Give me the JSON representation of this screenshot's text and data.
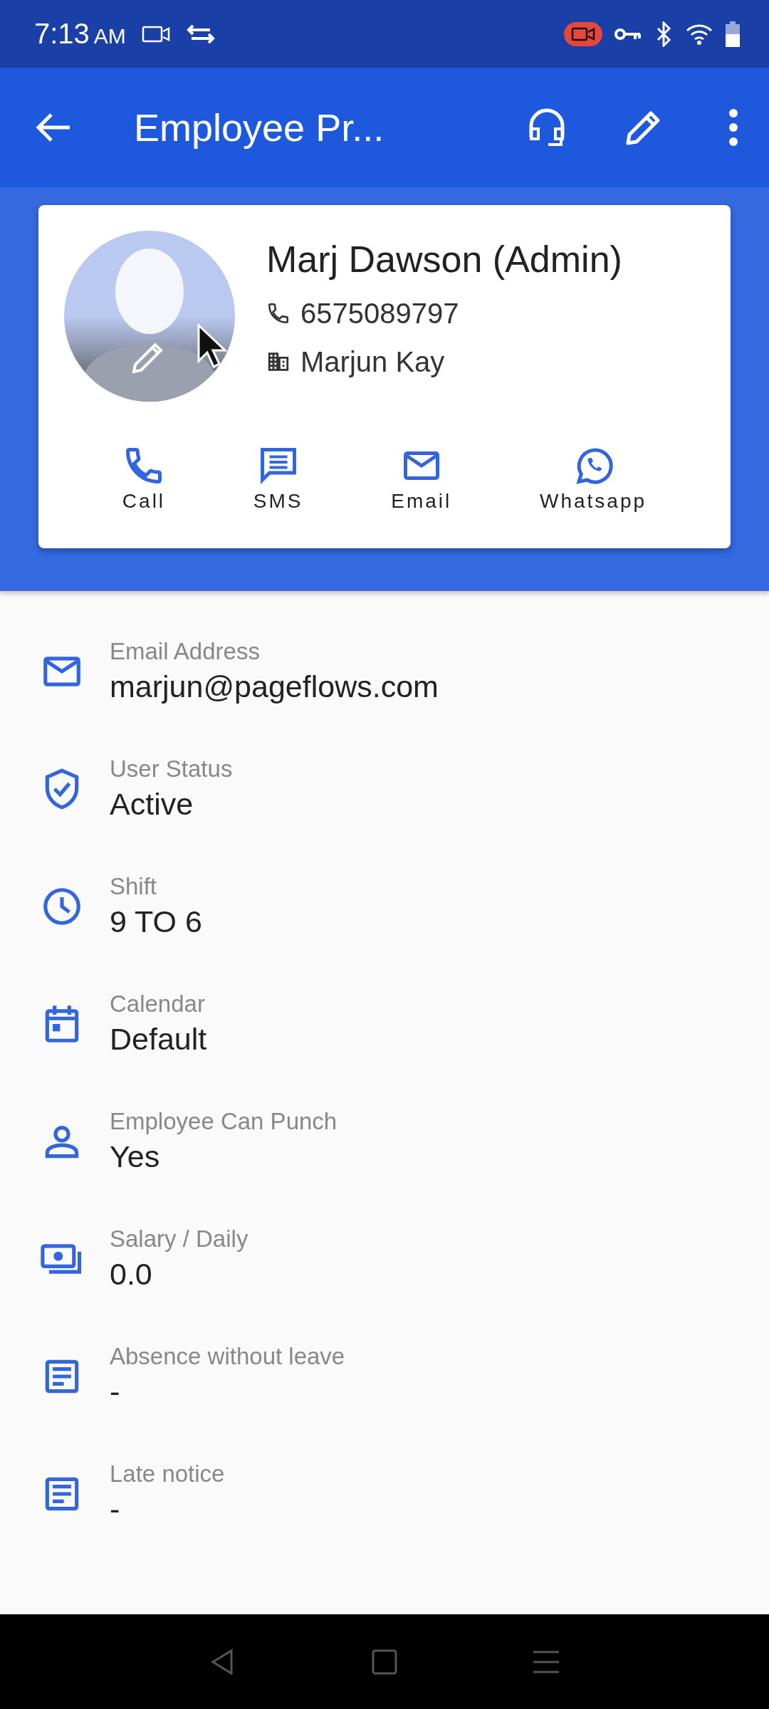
{
  "status_bar": {
    "time": "7:13",
    "ampm": "AM"
  },
  "app_bar": {
    "title": "Employee Pr..."
  },
  "profile": {
    "name": "Marj Dawson (Admin)",
    "phone": "6575089797",
    "company": "Marjun Kay"
  },
  "actions": [
    {
      "kind": "call",
      "label": "Call"
    },
    {
      "kind": "sms",
      "label": "SMS"
    },
    {
      "kind": "email",
      "label": "Email"
    },
    {
      "kind": "whatsapp",
      "label": "Whatsapp"
    }
  ],
  "fields": [
    {
      "kind": "email",
      "label": "Email Address",
      "value": "marjun@pageflows.com"
    },
    {
      "kind": "shield",
      "label": "User Status",
      "value": "Active"
    },
    {
      "kind": "clock",
      "label": "Shift",
      "value": "9 TO 6"
    },
    {
      "kind": "calendar",
      "label": "Calendar",
      "value": "Default"
    },
    {
      "kind": "person",
      "label": "Employee Can Punch",
      "value": "Yes"
    },
    {
      "kind": "money",
      "label": "Salary / Daily",
      "value": "0.0"
    },
    {
      "kind": "notes",
      "label": "Absence without leave",
      "value": "-"
    },
    {
      "kind": "notes",
      "label": "Late notice",
      "value": "-"
    }
  ]
}
